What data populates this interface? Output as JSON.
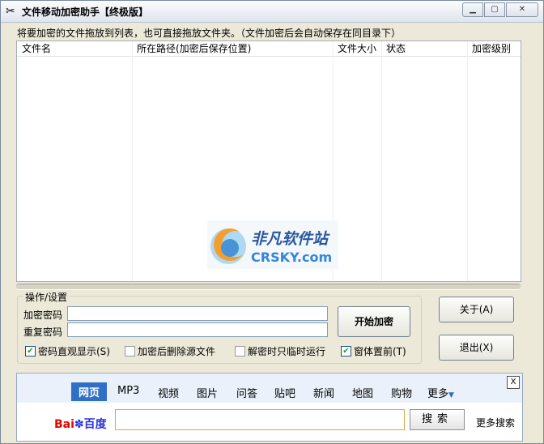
{
  "window": {
    "title": "文件移动加密助手【终极版】"
  },
  "hint": "将要加密的文件拖放到列表，也可直接拖放文件夹。（文件加密后会自动保存在同目录下）",
  "list": {
    "columns": [
      "文件名",
      "所在路径(加密后保存位置)",
      "文件大小",
      "状态",
      "加密级别"
    ]
  },
  "watermark": {
    "brand": "非凡软件站",
    "site": "CRSKY.com"
  },
  "settings": {
    "group_title": "操作/设置",
    "password_label": "加密密码",
    "repeat_label": "重复密码",
    "password_value": "",
    "repeat_value": "",
    "start_button": "开始加密",
    "checkboxes": [
      {
        "label": "密码直观显示(S)",
        "checked": true
      },
      {
        "label": "加密后删除源文件",
        "checked": false
      },
      {
        "label": "解密时只临时运行",
        "checked": false
      },
      {
        "label": "窗体置前(T)",
        "checked": true
      }
    ]
  },
  "side_buttons": {
    "about": "关于(A)",
    "exit": "退出(X)"
  },
  "baidu": {
    "tabs": [
      "网页",
      "MP3",
      "视频",
      "图片",
      "问答",
      "贴吧",
      "新闻",
      "地图",
      "购物",
      "更多"
    ],
    "selected_tab": "网页",
    "logo_bai": "Bai",
    "logo_du": "百度",
    "search_value": "",
    "search_button": "搜索",
    "more_search": "更多搜索",
    "close": "X"
  }
}
